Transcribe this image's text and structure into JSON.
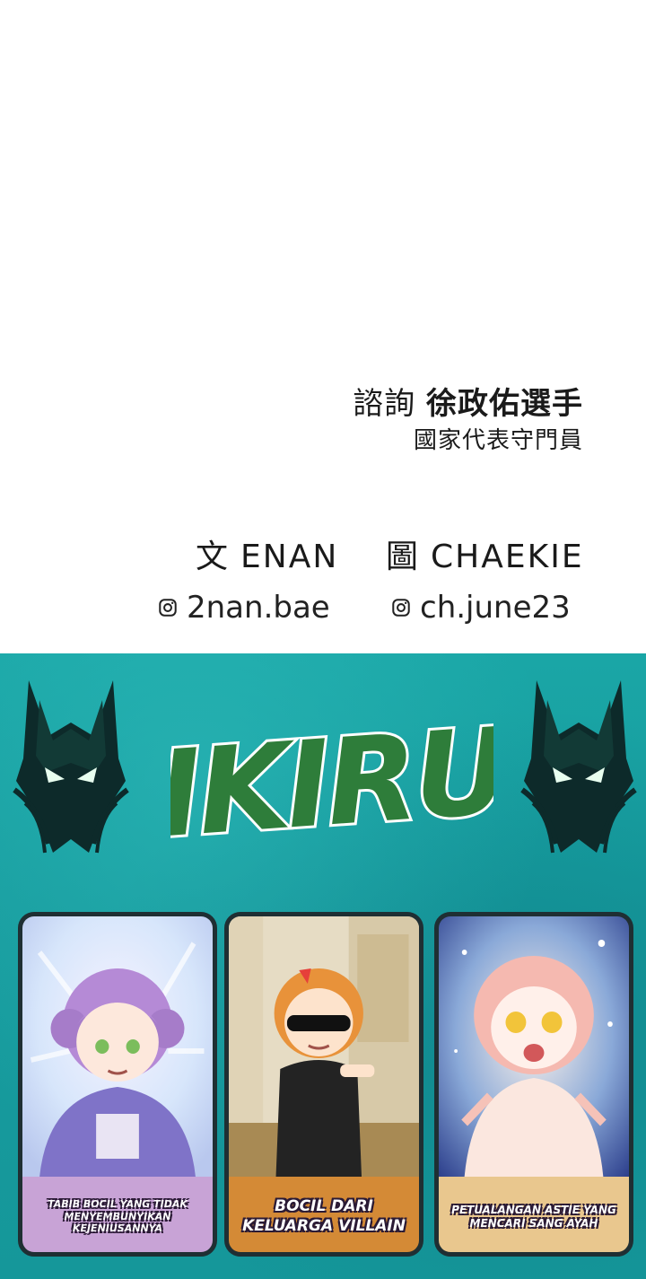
{
  "credits": {
    "consult_prefix": "諮詢",
    "consult_name": "徐政佑選手",
    "consult_role": "國家代表守門員",
    "writer_label": "文",
    "writer_name": "ENAN",
    "artist_label": "圖",
    "artist_name": "CHAEKIE",
    "writer_handle": "2nan.bae",
    "artist_handle": "ch.june23",
    "handle_icon": "instagram-icon"
  },
  "banner": {
    "logo_text": "IKIRU",
    "emblem_icon": "wolf-head-emblem",
    "colors": {
      "background": "#179c9e",
      "logo_fill": "#2e7d3a",
      "logo_outline": "#ffffff"
    },
    "cards": [
      {
        "caption": "TABIB BOCIL YANG TIDAK MENYEMBUNYIKAN KEJENIUSANNYA",
        "accent": "#c8a3d6"
      },
      {
        "caption": "BOCIL DARI KELUARGA VILLAIN",
        "accent": "#d48a36"
      },
      {
        "caption": "PETUALANGAN ASTIE YANG MENCARI SANG AYAH",
        "accent": "#e9c78e"
      }
    ]
  }
}
